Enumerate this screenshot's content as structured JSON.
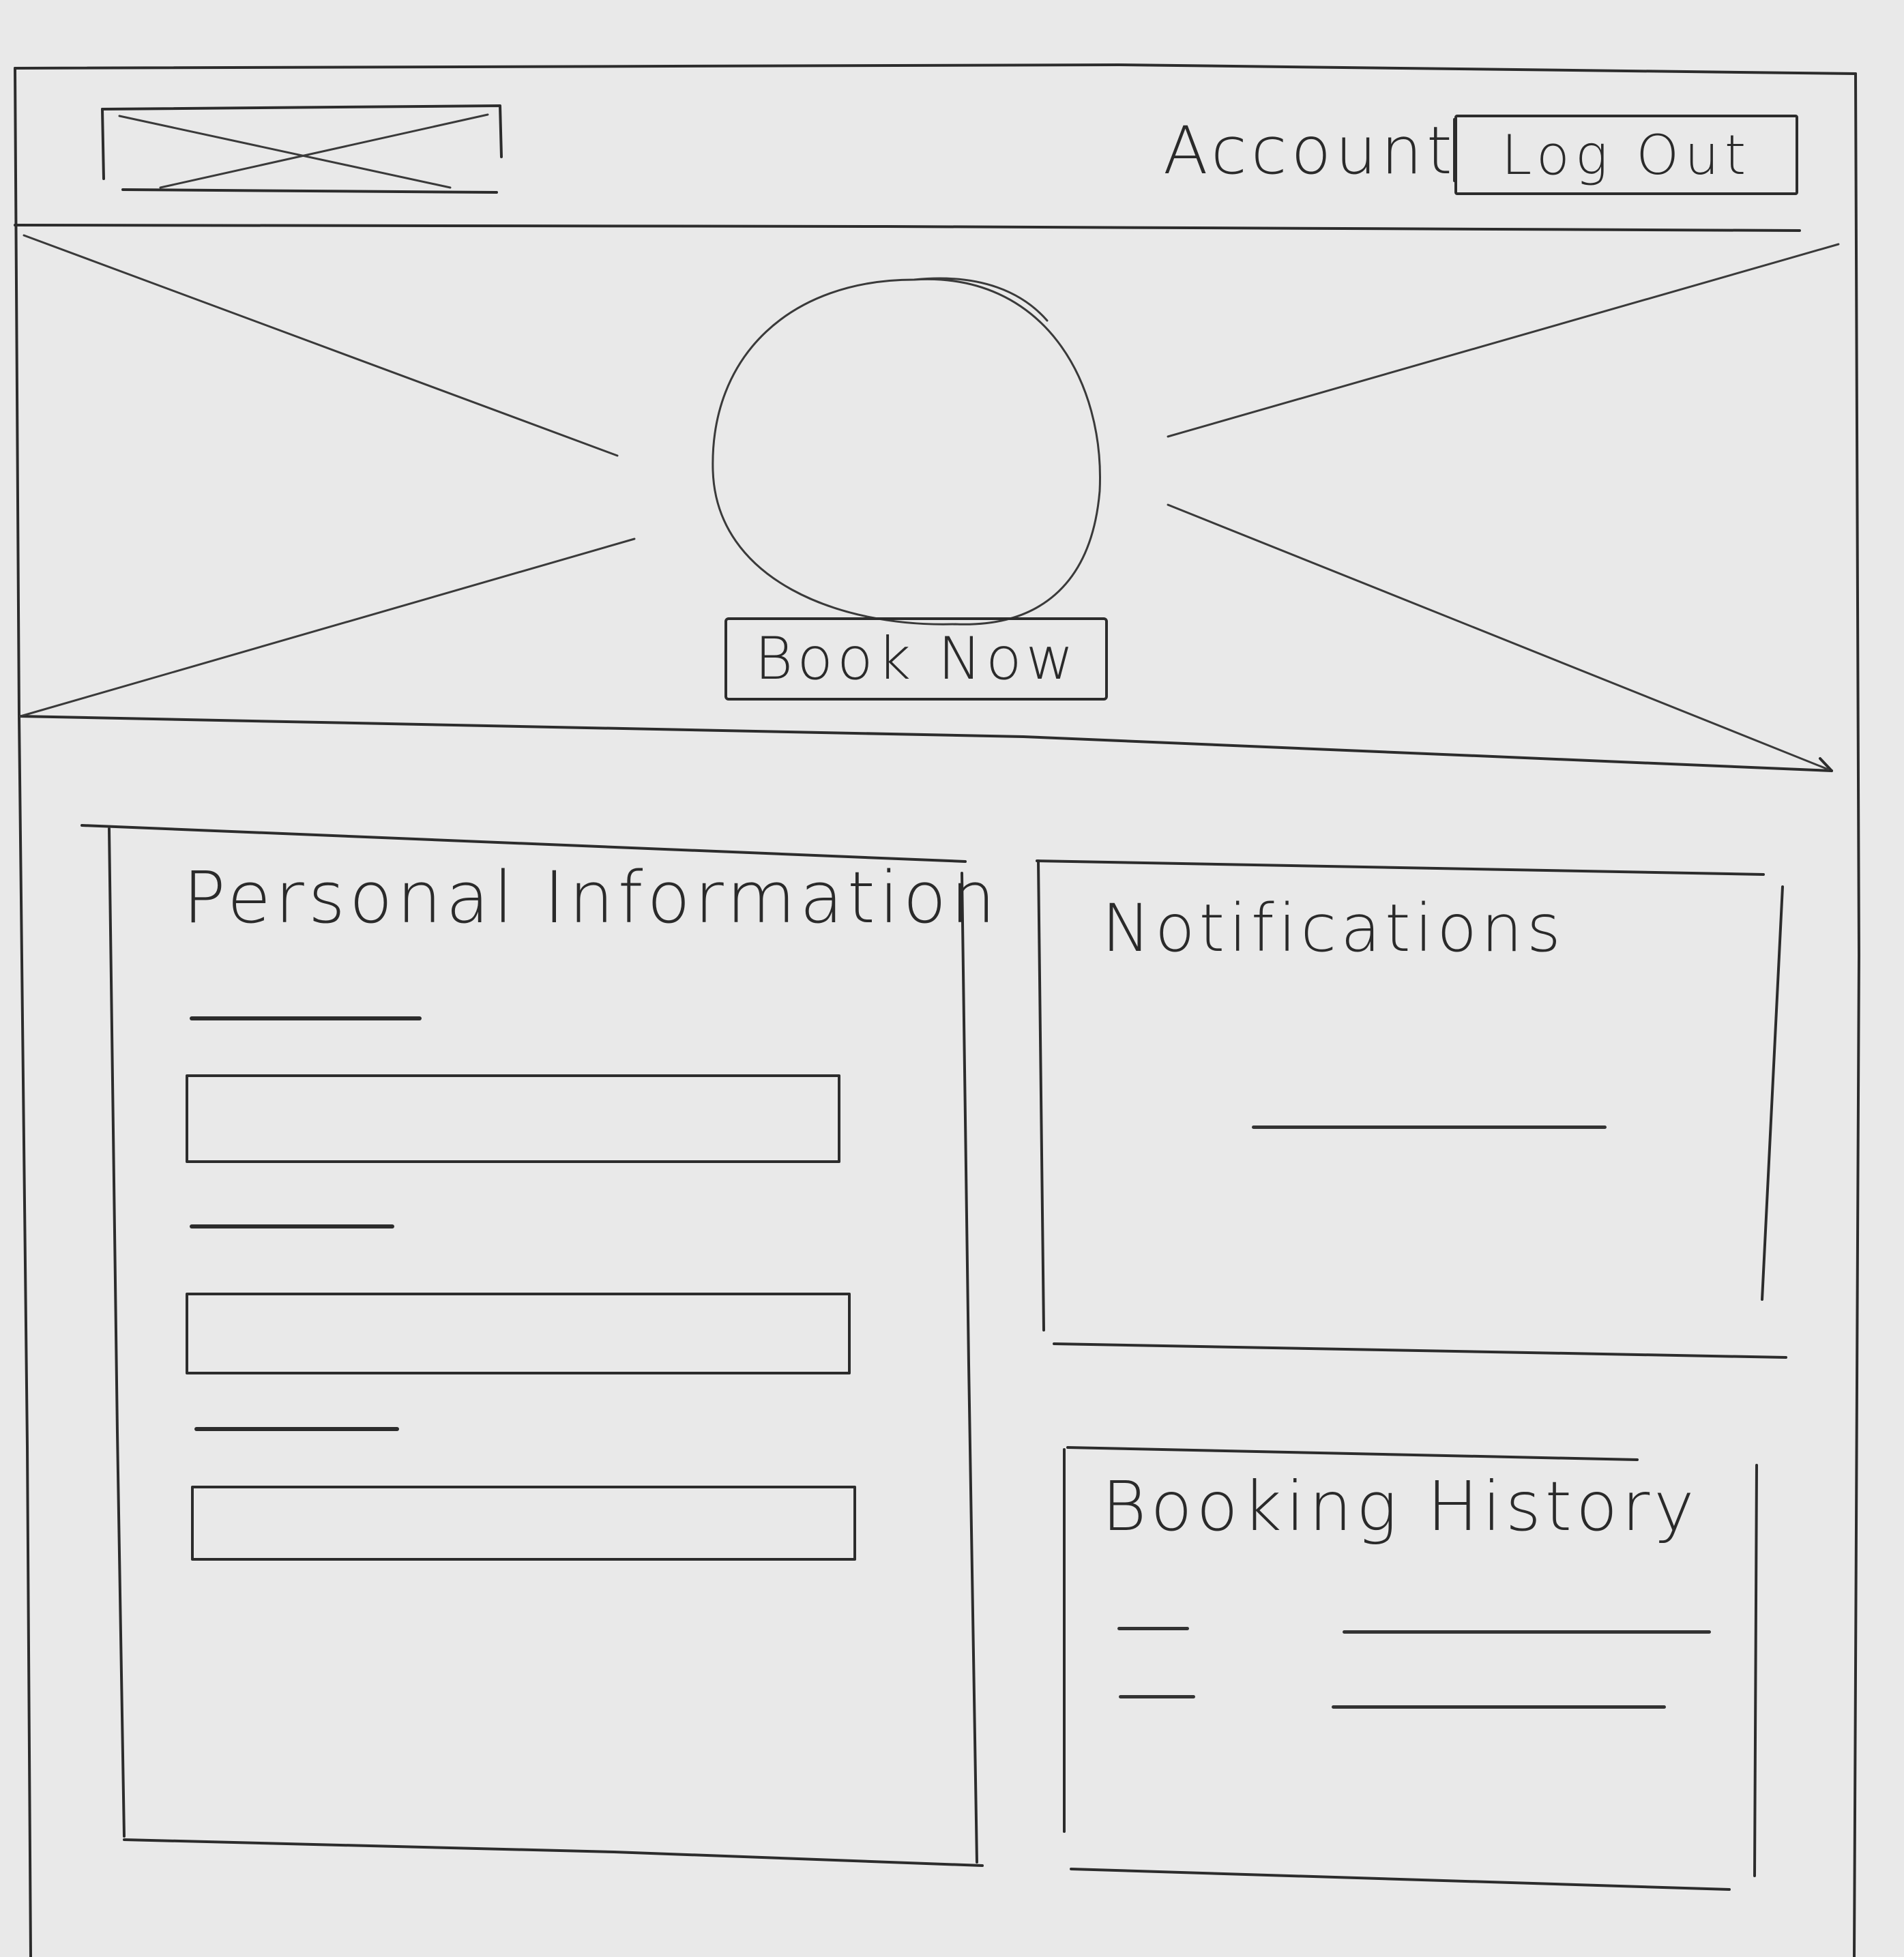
{
  "header": {
    "logo_icon": "image-placeholder-icon",
    "account_label": "Account",
    "logout_label": "Log Out"
  },
  "hero": {
    "image_icon": "image-placeholder-icon",
    "avatar_icon": "circle-avatar-icon",
    "book_now_label": "Book Now"
  },
  "personal_information": {
    "title": "Personal Information",
    "fields": [
      {
        "label": "",
        "value": ""
      },
      {
        "label": "",
        "value": ""
      },
      {
        "label": "",
        "value": ""
      }
    ]
  },
  "notifications": {
    "title": "Notifications",
    "items": [
      ""
    ]
  },
  "booking_history": {
    "title": "Booking History",
    "rows": [
      {
        "date": "",
        "detail": ""
      },
      {
        "date": "",
        "detail": ""
      }
    ]
  }
}
